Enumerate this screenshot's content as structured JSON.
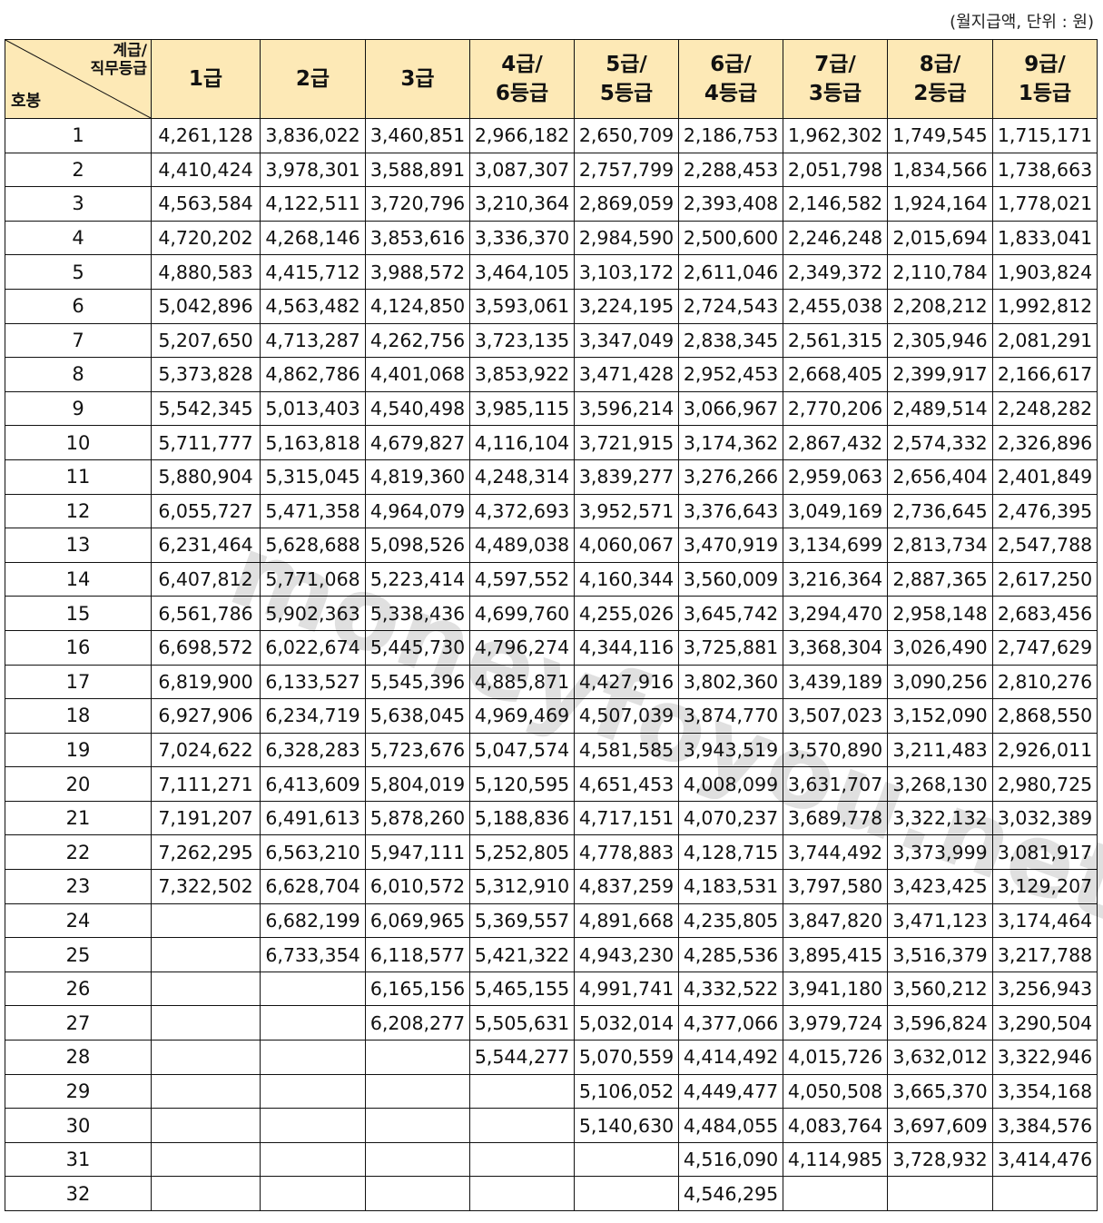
{
  "unit_note": "(월지급액, 단위 : 원)",
  "watermark": "moneyfoyou.net",
  "corner": {
    "top_line1": "계급/",
    "top_line2": "직무등급",
    "bottom": "호봉"
  },
  "columns": [
    {
      "l1": "1급",
      "l2": ""
    },
    {
      "l1": "2급",
      "l2": ""
    },
    {
      "l1": "3급",
      "l2": ""
    },
    {
      "l1": "4급/",
      "l2": "6등급"
    },
    {
      "l1": "5급/",
      "l2": "5등급"
    },
    {
      "l1": "6급/",
      "l2": "4등급"
    },
    {
      "l1": "7급/",
      "l2": "3등급"
    },
    {
      "l1": "8급/",
      "l2": "2등급"
    },
    {
      "l1": "9급/",
      "l2": "1등급"
    }
  ],
  "rows": [
    {
      "step": "1",
      "v": [
        "4,261,128",
        "3,836,022",
        "3,460,851",
        "2,966,182",
        "2,650,709",
        "2,186,753",
        "1,962,302",
        "1,749,545",
        "1,715,171"
      ]
    },
    {
      "step": "2",
      "v": [
        "4,410,424",
        "3,978,301",
        "3,588,891",
        "3,087,307",
        "2,757,799",
        "2,288,453",
        "2,051,798",
        "1,834,566",
        "1,738,663"
      ]
    },
    {
      "step": "3",
      "v": [
        "4,563,584",
        "4,122,511",
        "3,720,796",
        "3,210,364",
        "2,869,059",
        "2,393,408",
        "2,146,582",
        "1,924,164",
        "1,778,021"
      ]
    },
    {
      "step": "4",
      "v": [
        "4,720,202",
        "4,268,146",
        "3,853,616",
        "3,336,370",
        "2,984,590",
        "2,500,600",
        "2,246,248",
        "2,015,694",
        "1,833,041"
      ]
    },
    {
      "step": "5",
      "v": [
        "4,880,583",
        "4,415,712",
        "3,988,572",
        "3,464,105",
        "3,103,172",
        "2,611,046",
        "2,349,372",
        "2,110,784",
        "1,903,824"
      ]
    },
    {
      "step": "6",
      "v": [
        "5,042,896",
        "4,563,482",
        "4,124,850",
        "3,593,061",
        "3,224,195",
        "2,724,543",
        "2,455,038",
        "2,208,212",
        "1,992,812"
      ]
    },
    {
      "step": "7",
      "v": [
        "5,207,650",
        "4,713,287",
        "4,262,756",
        "3,723,135",
        "3,347,049",
        "2,838,345",
        "2,561,315",
        "2,305,946",
        "2,081,291"
      ]
    },
    {
      "step": "8",
      "v": [
        "5,373,828",
        "4,862,786",
        "4,401,068",
        "3,853,922",
        "3,471,428",
        "2,952,453",
        "2,668,405",
        "2,399,917",
        "2,166,617"
      ]
    },
    {
      "step": "9",
      "v": [
        "5,542,345",
        "5,013,403",
        "4,540,498",
        "3,985,115",
        "3,596,214",
        "3,066,967",
        "2,770,206",
        "2,489,514",
        "2,248,282"
      ]
    },
    {
      "step": "10",
      "v": [
        "5,711,777",
        "5,163,818",
        "4,679,827",
        "4,116,104",
        "3,721,915",
        "3,174,362",
        "2,867,432",
        "2,574,332",
        "2,326,896"
      ]
    },
    {
      "step": "11",
      "v": [
        "5,880,904",
        "5,315,045",
        "4,819,360",
        "4,248,314",
        "3,839,277",
        "3,276,266",
        "2,959,063",
        "2,656,404",
        "2,401,849"
      ]
    },
    {
      "step": "12",
      "v": [
        "6,055,727",
        "5,471,358",
        "4,964,079",
        "4,372,693",
        "3,952,571",
        "3,376,643",
        "3,049,169",
        "2,736,645",
        "2,476,395"
      ]
    },
    {
      "step": "13",
      "v": [
        "6,231,464",
        "5,628,688",
        "5,098,526",
        "4,489,038",
        "4,060,067",
        "3,470,919",
        "3,134,699",
        "2,813,734",
        "2,547,788"
      ]
    },
    {
      "step": "14",
      "v": [
        "6,407,812",
        "5,771,068",
        "5,223,414",
        "4,597,552",
        "4,160,344",
        "3,560,009",
        "3,216,364",
        "2,887,365",
        "2,617,250"
      ]
    },
    {
      "step": "15",
      "v": [
        "6,561,786",
        "5,902,363",
        "5,338,436",
        "4,699,760",
        "4,255,026",
        "3,645,742",
        "3,294,470",
        "2,958,148",
        "2,683,456"
      ]
    },
    {
      "step": "16",
      "v": [
        "6,698,572",
        "6,022,674",
        "5,445,730",
        "4,796,274",
        "4,344,116",
        "3,725,881",
        "3,368,304",
        "3,026,490",
        "2,747,629"
      ]
    },
    {
      "step": "17",
      "v": [
        "6,819,900",
        "6,133,527",
        "5,545,396",
        "4,885,871",
        "4,427,916",
        "3,802,360",
        "3,439,189",
        "3,090,256",
        "2,810,276"
      ]
    },
    {
      "step": "18",
      "v": [
        "6,927,906",
        "6,234,719",
        "5,638,045",
        "4,969,469",
        "4,507,039",
        "3,874,770",
        "3,507,023",
        "3,152,090",
        "2,868,550"
      ]
    },
    {
      "step": "19",
      "v": [
        "7,024,622",
        "6,328,283",
        "5,723,676",
        "5,047,574",
        "4,581,585",
        "3,943,519",
        "3,570,890",
        "3,211,483",
        "2,926,011"
      ]
    },
    {
      "step": "20",
      "v": [
        "7,111,271",
        "6,413,609",
        "5,804,019",
        "5,120,595",
        "4,651,453",
        "4,008,099",
        "3,631,707",
        "3,268,130",
        "2,980,725"
      ]
    },
    {
      "step": "21",
      "v": [
        "7,191,207",
        "6,491,613",
        "5,878,260",
        "5,188,836",
        "4,717,151",
        "4,070,237",
        "3,689,778",
        "3,322,132",
        "3,032,389"
      ]
    },
    {
      "step": "22",
      "v": [
        "7,262,295",
        "6,563,210",
        "5,947,111",
        "5,252,805",
        "4,778,883",
        "4,128,715",
        "3,744,492",
        "3,373,999",
        "3,081,917"
      ]
    },
    {
      "step": "23",
      "v": [
        "7,322,502",
        "6,628,704",
        "6,010,572",
        "5,312,910",
        "4,837,259",
        "4,183,531",
        "3,797,580",
        "3,423,425",
        "3,129,207"
      ]
    },
    {
      "step": "24",
      "v": [
        "",
        "6,682,199",
        "6,069,965",
        "5,369,557",
        "4,891,668",
        "4,235,805",
        "3,847,820",
        "3,471,123",
        "3,174,464"
      ]
    },
    {
      "step": "25",
      "v": [
        "",
        "6,733,354",
        "6,118,577",
        "5,421,322",
        "4,943,230",
        "4,285,536",
        "3,895,415",
        "3,516,379",
        "3,217,788"
      ]
    },
    {
      "step": "26",
      "v": [
        "",
        "",
        "6,165,156",
        "5,465,155",
        "4,991,741",
        "4,332,522",
        "3,941,180",
        "3,560,212",
        "3,256,943"
      ]
    },
    {
      "step": "27",
      "v": [
        "",
        "",
        "6,208,277",
        "5,505,631",
        "5,032,014",
        "4,377,066",
        "3,979,724",
        "3,596,824",
        "3,290,504"
      ]
    },
    {
      "step": "28",
      "v": [
        "",
        "",
        "",
        "5,544,277",
        "5,070,559",
        "4,414,492",
        "4,015,726",
        "3,632,012",
        "3,322,946"
      ]
    },
    {
      "step": "29",
      "v": [
        "",
        "",
        "",
        "",
        "5,106,052",
        "4,449,477",
        "4,050,508",
        "3,665,370",
        "3,354,168"
      ]
    },
    {
      "step": "30",
      "v": [
        "",
        "",
        "",
        "",
        "5,140,630",
        "4,484,055",
        "4,083,764",
        "3,697,609",
        "3,384,576"
      ]
    },
    {
      "step": "31",
      "v": [
        "",
        "",
        "",
        "",
        "",
        "4,516,090",
        "4,114,985",
        "3,728,932",
        "3,414,476"
      ]
    },
    {
      "step": "32",
      "v": [
        "",
        "",
        "",
        "",
        "",
        "4,546,295",
        "",
        "",
        ""
      ]
    }
  ]
}
